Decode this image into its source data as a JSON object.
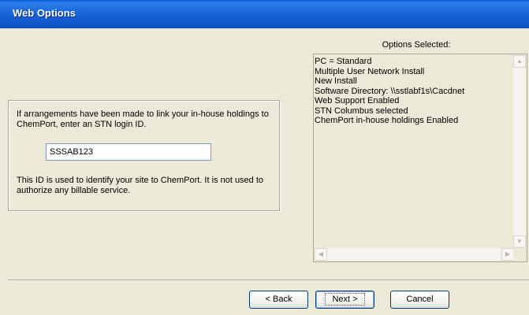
{
  "window": {
    "title": "Web Options"
  },
  "login_panel": {
    "instructions": "If arrangements have been made to link your in-house holdings to ChemPort, enter an STN login ID.",
    "login_id_value": "SSSAB123",
    "note": "This ID is used to identify your site to ChemPort.  It is not used to authorize any billable service."
  },
  "options": {
    "label": "Options Selected:",
    "items": [
      "PC = Standard",
      "Multiple User Network Install",
      "New Install",
      "Software Directory: \\\\sstlabf1s\\Cacdnet",
      "Web Support Enabled",
      "STN Columbus selected",
      "ChemPort in-house holdings Enabled"
    ]
  },
  "buttons": {
    "back": "< Back",
    "next": "Next >",
    "cancel": "Cancel"
  },
  "icons": {
    "scroll_up": "scroll-up-arrow-icon",
    "scroll_down": "scroll-down-arrow-icon",
    "scroll_left": "scroll-left-arrow-icon",
    "scroll_right": "scroll-right-arrow-icon"
  },
  "colors": {
    "title_bar": "#0f4fc2",
    "dialog_background": "#ece9d8",
    "input_border": "#7f9db9"
  }
}
